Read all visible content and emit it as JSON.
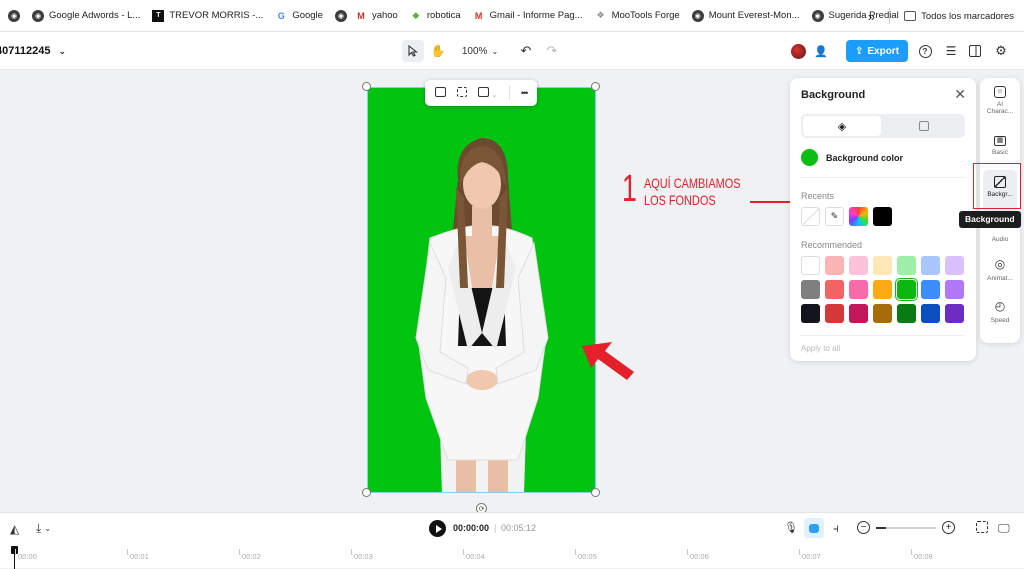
{
  "bookmarks": {
    "items": [
      {
        "label": "Google Adwords - L...",
        "icon": "globe-icon"
      },
      {
        "label": "TREVOR MORRIS -...",
        "icon": "t-logo-icon"
      },
      {
        "label": "Google",
        "icon": "google-icon"
      },
      {
        "label": "",
        "icon": "globe-icon"
      },
      {
        "label": "yahoo",
        "icon": "gmail-icon"
      },
      {
        "label": "robotica",
        "icon": "robotica-icon"
      },
      {
        "label": "Gmail - Informe Pag...",
        "icon": "gmail-icon"
      },
      {
        "label": "MooTools Forge",
        "icon": "mootools-icon"
      },
      {
        "label": "Mount Everest-Mon...",
        "icon": "globe-icon"
      },
      {
        "label": "Sugerida Predial",
        "icon": "globe-icon"
      }
    ],
    "overflow": "»",
    "all_bookmarks": "Todos los marcadores"
  },
  "toolbar": {
    "project_name": "407112245",
    "zoom": "100%",
    "export_label": "Export"
  },
  "float_toolbar": {
    "more": "•••"
  },
  "panel": {
    "title": "Background",
    "color_label": "Background color",
    "recents_label": "Recents",
    "recommended_label": "Recommended",
    "apply_all": "Apply to all",
    "selected_color": "#0bbf12",
    "recents": [
      "#ffffff",
      "eyedropper",
      "gradient",
      "#000000"
    ],
    "recommended": [
      [
        "#ffffff",
        "#fbb4b4",
        "#fcc2d9",
        "#fde7b4",
        "#9ef0a8",
        "#a8c7fb",
        "#d9c2fb"
      ],
      [
        "#7f7f7f",
        "#f36363",
        "#f76ca8",
        "#fcaa14",
        "#0db712",
        "#3d8efb",
        "#b178f7"
      ],
      [
        "#14141c",
        "#d43838",
        "#c2185b",
        "#a86b0a",
        "#0a7a12",
        "#0a4fbf",
        "#6c2ec2"
      ]
    ]
  },
  "rail": {
    "items": [
      {
        "label": "AI Charac...",
        "icon": "ai-character-icon"
      },
      {
        "label": "Basic",
        "icon": "film-icon"
      },
      {
        "label": "Backgr...",
        "icon": "background-icon"
      },
      {
        "label": "Audio",
        "icon": "audio-icon"
      },
      {
        "label": "Animat...",
        "icon": "animation-icon"
      },
      {
        "label": "Speed",
        "icon": "speed-icon"
      }
    ],
    "tooltip": "Background"
  },
  "annotation": {
    "number": "1",
    "line1": "AQUÍ CAMBIAMOS",
    "line2": "LOS FONDOS",
    "color": "#e4202b"
  },
  "timeline": {
    "current_time": "00:00:00",
    "separator": "|",
    "total_time": "00:05:12",
    "ticks": [
      "00:00",
      "00:01",
      "00:02",
      "00:03",
      "00:04",
      "00:05",
      "00:06",
      "00:07",
      "00:08"
    ]
  }
}
